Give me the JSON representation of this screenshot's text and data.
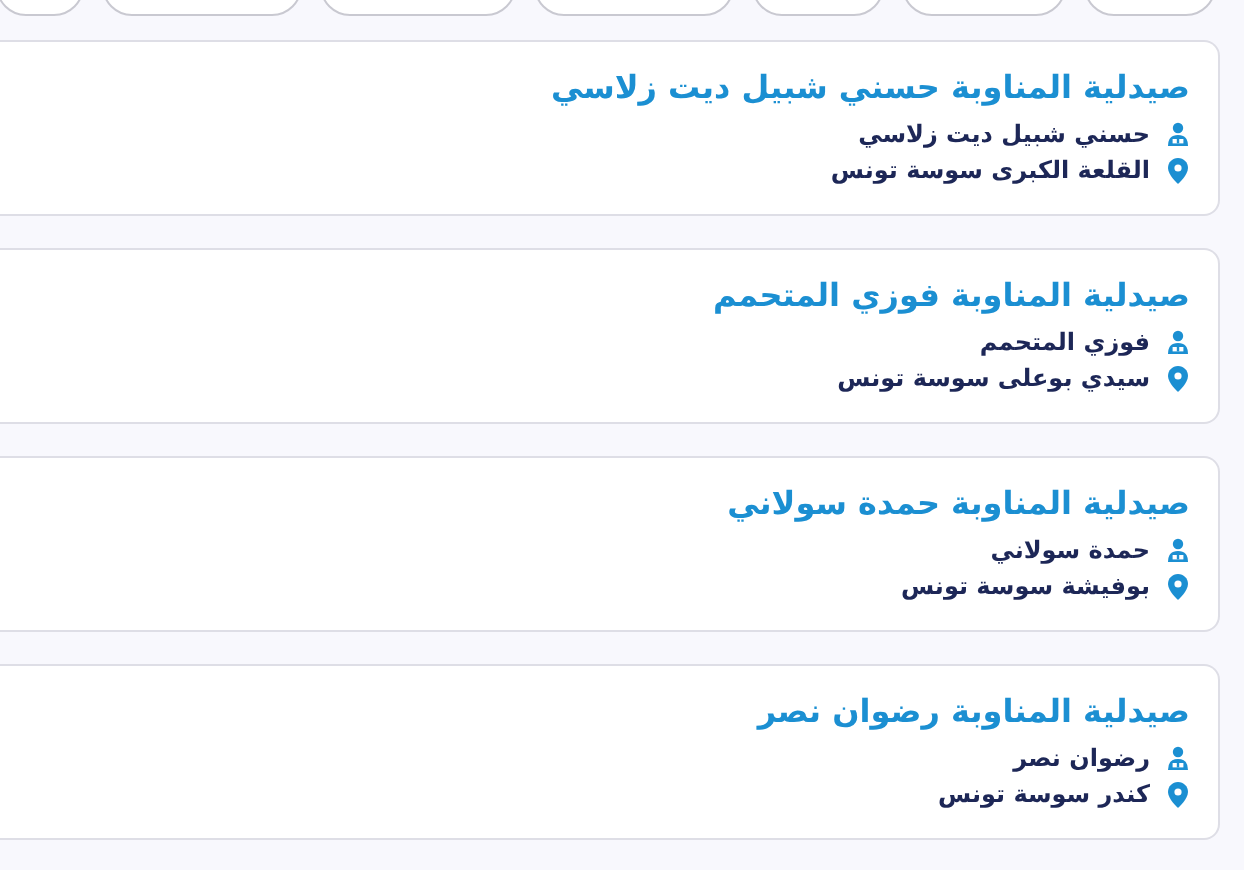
{
  "pharmacies": [
    {
      "title": "صيدلية المناوبة حسني شبيل ديت زلاسي",
      "owner": "حسني شبيل ديت زلاسي",
      "address": "القلعة الكبرى سوسة تونس"
    },
    {
      "title": "صيدلية المناوبة فوزي المتحمم",
      "owner": "فوزي المتحمم",
      "address": "سيدي بوعلى سوسة تونس"
    },
    {
      "title": "صيدلية المناوبة حمدة سولاني",
      "owner": "حمدة سولاني",
      "address": "بوفيشة سوسة تونس"
    },
    {
      "title": "صيدلية المناوبة رضوان نصر",
      "owner": "رضوان نصر",
      "address": "كندر سوسة تونس"
    }
  ]
}
